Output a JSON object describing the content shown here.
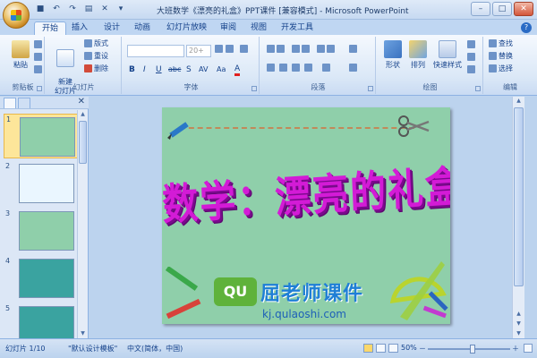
{
  "window": {
    "title": "大班数学《漂亮的礼盒》PPT课件 [兼容模式] - Microsoft PowerPoint",
    "qat_icons": [
      "save-icon",
      "undo-icon",
      "redo-icon",
      "print-preview-icon",
      "spelling-icon",
      "close-doc-icon"
    ],
    "qat_symbols": [
      "■",
      "↶",
      "↷",
      "▤",
      "✕",
      "▾"
    ],
    "controls": {
      "minimize": "–",
      "maximize": "□",
      "close": "✕"
    }
  },
  "tabs": [
    "开始",
    "插入",
    "设计",
    "动画",
    "幻灯片放映",
    "审阅",
    "视图",
    "开发工具"
  ],
  "help_symbol": "?",
  "ribbon": {
    "clipboard": {
      "paste": "粘贴",
      "label": "剪贴板"
    },
    "slides": {
      "new_slide": "新建\n幻灯片",
      "layout": "版式",
      "reset": "重设",
      "delete": "删除",
      "label": "幻灯片"
    },
    "font": {
      "size": "20+",
      "format_buttons": [
        "B",
        "I",
        "U",
        "abc",
        "S",
        "AV",
        "Aa",
        "A"
      ],
      "label": "字体"
    },
    "paragraph": {
      "label": "段落"
    },
    "drawing": {
      "shape": "形状",
      "arrange": "排列",
      "quick_styles": "快速样式",
      "label": "绘图"
    },
    "editing": {
      "find": "查找",
      "replace": "替换",
      "select": "选择",
      "label": "编辑"
    }
  },
  "slides_panel": {
    "close_symbol": "✕",
    "thumbnails": [
      {
        "num": "1",
        "selected": true,
        "bg": "#8fcfaa"
      },
      {
        "num": "2",
        "selected": false,
        "bg": "#eaf6ff"
      },
      {
        "num": "3",
        "selected": false,
        "bg": "#8fcfaa"
      },
      {
        "num": "4",
        "selected": false,
        "bg": "#3aa3a0"
      },
      {
        "num": "5",
        "selected": false,
        "bg": "#3aa3a0"
      }
    ]
  },
  "slide": {
    "title": "数学：漂亮的礼盒",
    "logo_badge": "QU",
    "logo_text": "屈老师课件",
    "logo_url": "kj.qulaoshi.com"
  },
  "status": {
    "slide_pos": "幻灯片 1/10",
    "theme": "\"默认设计模板\"",
    "language": "中文(简体，中国)",
    "zoom": "50%",
    "zoom_minus": "－",
    "zoom_plus": "＋"
  }
}
